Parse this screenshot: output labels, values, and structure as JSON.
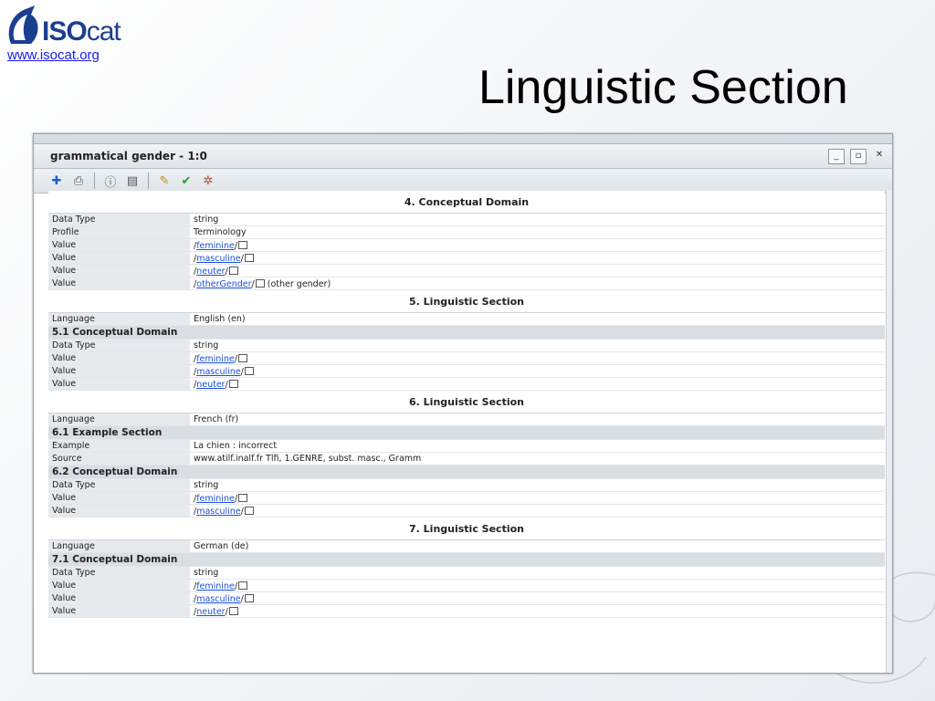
{
  "slide": {
    "logo_iso": "ISO",
    "logo_cat": "cat",
    "site_link": "www.isocat.org",
    "title": "Linguistic Section"
  },
  "window": {
    "title": "grammatical gender - 1:0",
    "btn_minimize": "_",
    "btn_restore": "▫",
    "btn_close": "✕"
  },
  "toolbar": [
    "add-icon",
    "print-icon",
    "info-icon",
    "properties-icon",
    "edit-icon",
    "check-icon",
    "network-icon"
  ],
  "rows": [
    {
      "type": "sec",
      "label": "4. Conceptual Domain"
    },
    {
      "type": "row",
      "k": "Data Type",
      "v": "string"
    },
    {
      "type": "row",
      "k": "Profile",
      "v": "Terminology"
    },
    {
      "type": "val",
      "k": "Value",
      "link": "feminine"
    },
    {
      "type": "val",
      "k": "Value",
      "link": "masculine"
    },
    {
      "type": "val",
      "k": "Value",
      "link": "neuter"
    },
    {
      "type": "val",
      "k": "Value",
      "link": "otherGender",
      "after": " (other gender)"
    },
    {
      "type": "sec",
      "label": "5. Linguistic Section"
    },
    {
      "type": "row",
      "k": "Language",
      "v": "English (en)"
    },
    {
      "type": "sub",
      "label": "5.1 Conceptual Domain"
    },
    {
      "type": "row",
      "k": "Data Type",
      "v": "string"
    },
    {
      "type": "val",
      "k": "Value",
      "link": "feminine"
    },
    {
      "type": "val",
      "k": "Value",
      "link": "masculine"
    },
    {
      "type": "val",
      "k": "Value",
      "link": "neuter"
    },
    {
      "type": "sec",
      "label": "6. Linguistic Section"
    },
    {
      "type": "row",
      "k": "Language",
      "v": "French (fr)"
    },
    {
      "type": "sub",
      "label": "6.1 Example Section"
    },
    {
      "type": "row",
      "k": "Example",
      "v": "La chien : incorrect"
    },
    {
      "type": "row",
      "k": "Source",
      "v": "www.atilf.inalf.fr Tlfi, 1.GENRE, subst. masc., Gramm"
    },
    {
      "type": "sub",
      "label": "6.2 Conceptual Domain"
    },
    {
      "type": "row",
      "k": "Data Type",
      "v": "string"
    },
    {
      "type": "val",
      "k": "Value",
      "link": "feminine"
    },
    {
      "type": "val",
      "k": "Value",
      "link": "masculine"
    },
    {
      "type": "sec",
      "label": "7. Linguistic Section"
    },
    {
      "type": "row",
      "k": "Language",
      "v": "German (de)"
    },
    {
      "type": "sub",
      "label": "7.1 Conceptual Domain"
    },
    {
      "type": "row",
      "k": "Data Type",
      "v": "string"
    },
    {
      "type": "val",
      "k": "Value",
      "link": "feminine"
    },
    {
      "type": "val",
      "k": "Value",
      "link": "masculine"
    },
    {
      "type": "val",
      "k": "Value",
      "link": "neuter"
    }
  ]
}
